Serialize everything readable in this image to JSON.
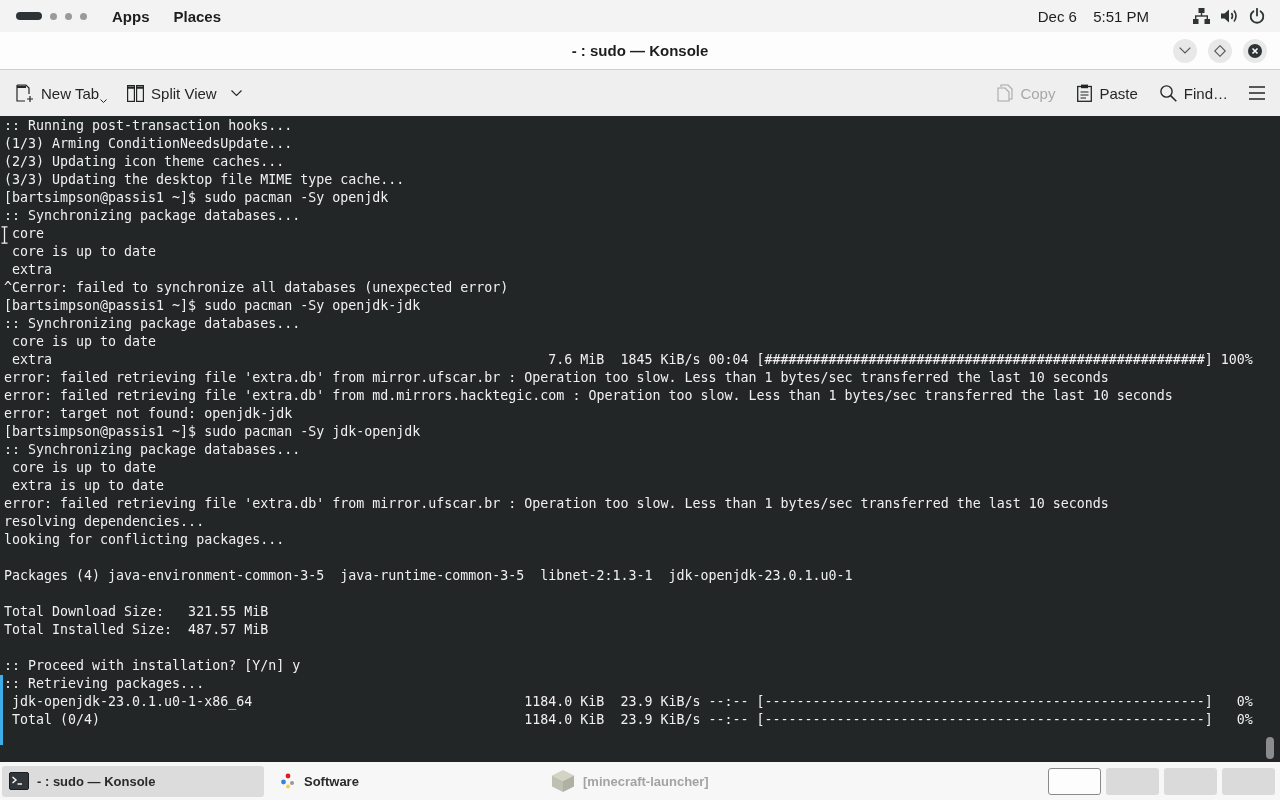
{
  "top_bar": {
    "workspaces": [
      {
        "selected": true
      },
      {
        "selected": false
      },
      {
        "selected": false
      },
      {
        "selected": false
      }
    ],
    "menus": [
      "Apps",
      "Places"
    ],
    "date": "Dec 6",
    "time": "5:51 PM"
  },
  "window": {
    "title": "- : sudo — Konsole"
  },
  "toolbar": {
    "left_buttons": [
      {
        "kind": "new_tab",
        "label": "New Tab",
        "disabled": false
      },
      {
        "kind": "split_view",
        "label": "Split View",
        "disabled": false
      }
    ],
    "right_buttons": [
      {
        "kind": "copy",
        "label": "Copy",
        "disabled": true
      },
      {
        "kind": "paste",
        "label": "Paste",
        "disabled": false
      },
      {
        "kind": "find",
        "label": "Find…",
        "disabled": false
      }
    ]
  },
  "terminal": {
    "lines": [
      {
        "kind": "text",
        "text": ":: Running post-transaction hooks..."
      },
      {
        "kind": "text",
        "text": "(1/3) Arming ConditionNeedsUpdate..."
      },
      {
        "kind": "text",
        "text": "(2/3) Updating icon theme caches..."
      },
      {
        "kind": "text",
        "text": "(3/3) Updating the desktop file MIME type cache..."
      },
      {
        "kind": "text",
        "text": "[bartsimpson@passis1 ~]$ sudo pacman -Sy openjdk"
      },
      {
        "kind": "text",
        "text": ":: Synchronizing package databases..."
      },
      {
        "kind": "indented",
        "text": "core"
      },
      {
        "kind": "indented",
        "text": "core is up to date"
      },
      {
        "kind": "indented",
        "text": "extra"
      },
      {
        "kind": "text",
        "text": "^Cerror: failed to synchronize all databases (unexpected error)"
      },
      {
        "kind": "text",
        "text": "[bartsimpson@passis1 ~]$ sudo pacman -Sy openjdk-jdk"
      },
      {
        "kind": "text",
        "text": ":: Synchronizing package databases..."
      },
      {
        "kind": "indented",
        "text": "core is up to date"
      },
      {
        "kind": "transfer",
        "name": "extra",
        "size": "7.6 MiB",
        "rate": "1845 KiB/s",
        "eta": "00:04",
        "marks": "[#######################################################]",
        "percent": "100%"
      },
      {
        "kind": "text",
        "text": "error: failed retrieving file 'extra.db' from mirror.ufscar.br : Operation too slow. Less than 1 bytes/sec transferred the last 10 seconds"
      },
      {
        "kind": "text",
        "text": "error: failed retrieving file 'extra.db' from md.mirrors.hacktegic.com : Operation too slow. Less than 1 bytes/sec transferred the last 10 seconds"
      },
      {
        "kind": "text",
        "text": "error: target not found: openjdk-jdk"
      },
      {
        "kind": "text",
        "text": "[bartsimpson@passis1 ~]$ sudo pacman -Sy jdk-openjdk"
      },
      {
        "kind": "text",
        "text": ":: Synchronizing package databases..."
      },
      {
        "kind": "indented",
        "text": "core is up to date"
      },
      {
        "kind": "indented",
        "text": "extra is up to date"
      },
      {
        "kind": "text",
        "text": "error: failed retrieving file 'extra.db' from mirror.ufscar.br : Operation too slow. Less than 1 bytes/sec transferred the last 10 seconds"
      },
      {
        "kind": "text",
        "text": "resolving dependencies..."
      },
      {
        "kind": "text",
        "text": "looking for conflicting packages..."
      },
      {
        "kind": "blank"
      },
      {
        "kind": "text",
        "text": "Packages (4) java-environment-common-3-5  java-runtime-common-3-5  libnet-2:1.3-1  jdk-openjdk-23.0.1.u0-1"
      },
      {
        "kind": "blank"
      },
      {
        "kind": "text",
        "text": "Total Download Size:   321.55 MiB"
      },
      {
        "kind": "text",
        "text": "Total Installed Size:  487.57 MiB"
      },
      {
        "kind": "blank"
      },
      {
        "kind": "text",
        "text": ":: Proceed with installation? [Y/n] y"
      },
      {
        "kind": "text",
        "text": ":: Retrieving packages..."
      },
      {
        "kind": "transfer",
        "name": "jdk-openjdk-23.0.1.u0-1-x86_64",
        "size": "1184.0 KiB",
        "rate": "23.9 KiB/s",
        "eta": "--:--",
        "marks": "[-------------------------------------------------------]",
        "percent": "0%"
      },
      {
        "kind": "transfer",
        "name": "Total (0/4)",
        "size": "1184.0 KiB",
        "rate": "23.9 KiB/s",
        "eta": "--:--",
        "marks": "[-------------------------------------------------------]",
        "percent": "0%"
      }
    ]
  },
  "taskbar": {
    "tasks": [
      {
        "kind": "terminal",
        "label": "- : sudo — Konsole",
        "selected": true,
        "minimized": false
      },
      {
        "kind": "software",
        "label": "Software",
        "selected": false,
        "minimized": false
      },
      {
        "kind": "cube",
        "label": "[minecraft-launcher]",
        "selected": false,
        "minimized": true
      }
    ],
    "workspaces": [
      {
        "selected": true
      },
      {
        "selected": false
      },
      {
        "selected": false
      },
      {
        "selected": false
      }
    ]
  }
}
